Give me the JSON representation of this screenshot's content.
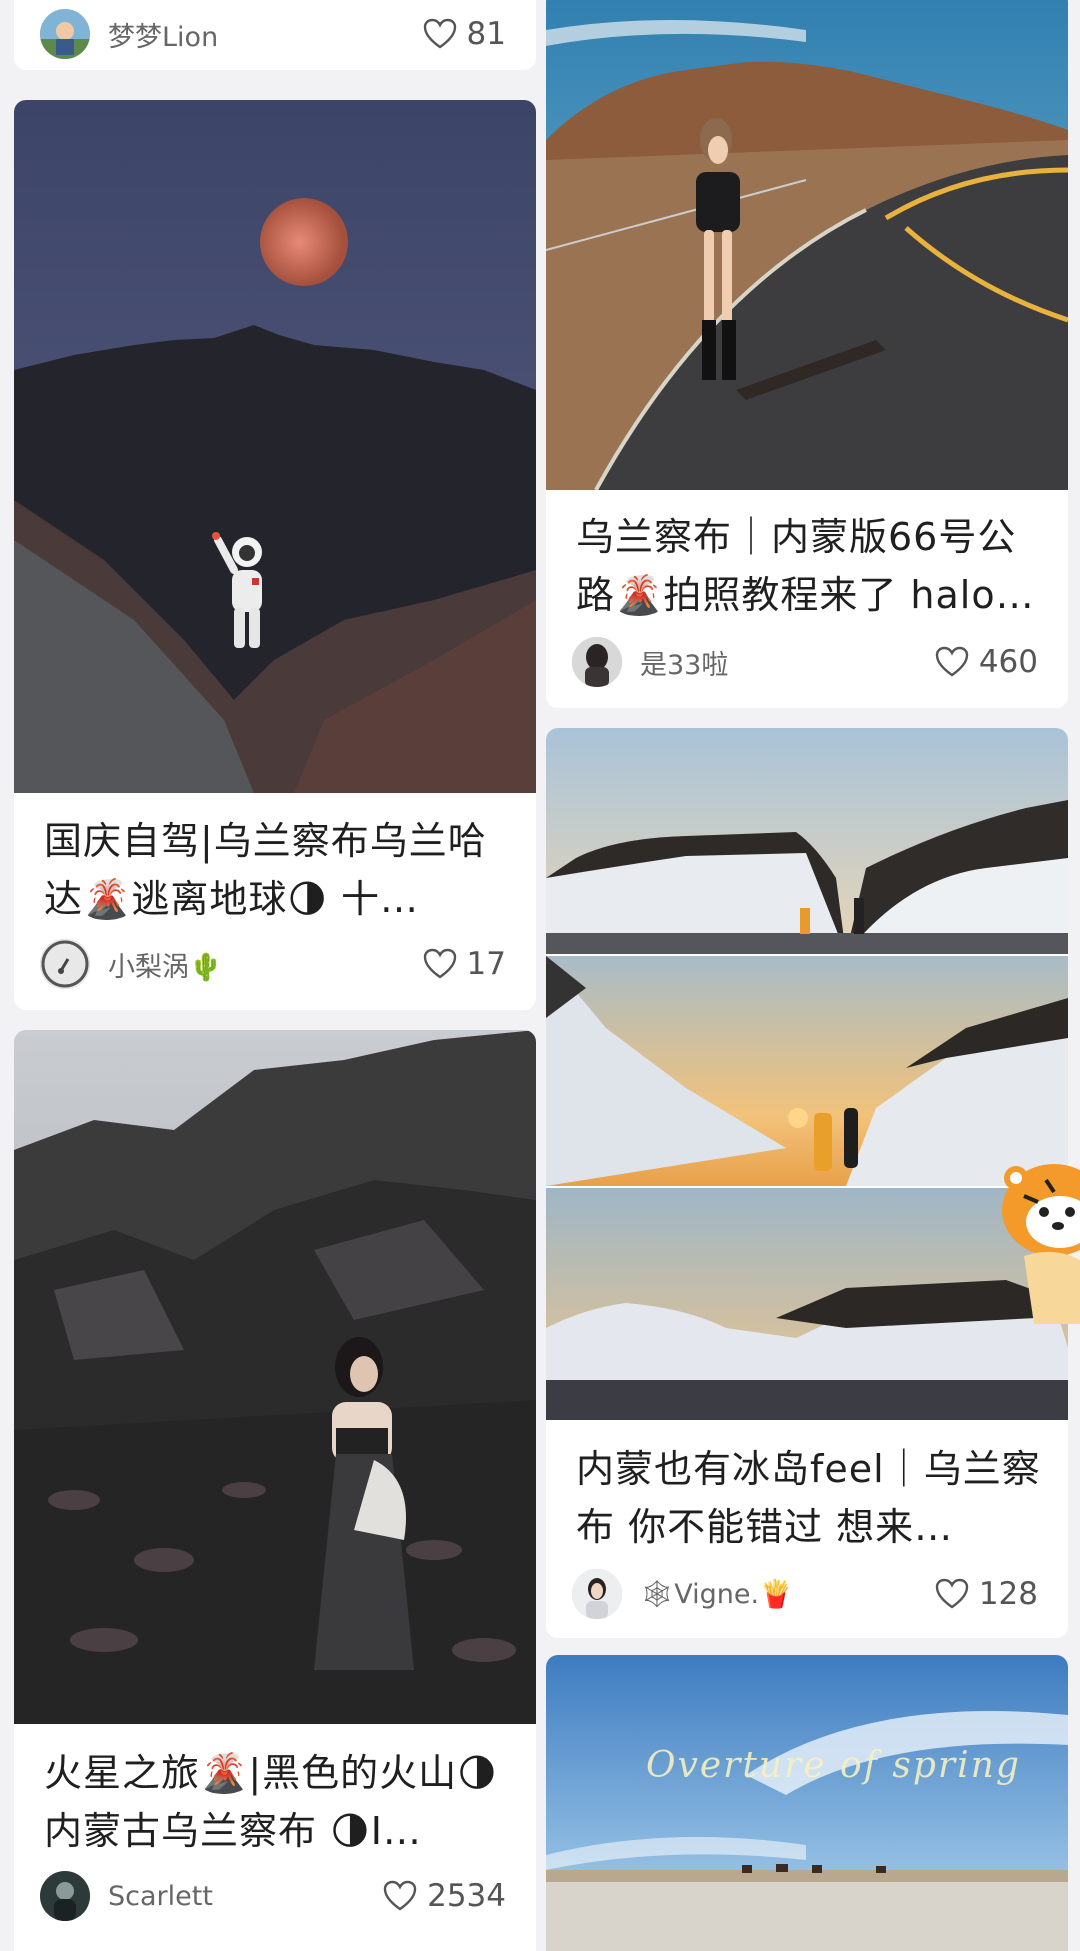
{
  "feed": {
    "left": [
      {
        "title": "",
        "author": "梦梦Lion",
        "likes": "81",
        "image": "",
        "avatar": "avatar-lion"
      },
      {
        "title": "国庆自驾|乌兰察布乌兰哈达🌋逃离地球🌗 十…",
        "author": "小梨涡🌵",
        "likes": "17",
        "image": "astronaut-under-blood-moon-on-volcanic-rock",
        "avatar": "avatar-round-icon"
      },
      {
        "title": "火星之旅🌋|黑色的火山🌗内蒙古乌兰察布 🌗I…",
        "author": "Scarlett",
        "likes": "2534",
        "image": "woman-in-black-dress-on-volcanic-field",
        "avatar": "avatar-scarlett"
      }
    ],
    "right": [
      {
        "title": "乌兰察布｜内蒙版66号公路🌋拍照教程来了 halo…",
        "author": "是33啦",
        "likes": "460",
        "image": "woman-walking-on-curved-road-by-volcano",
        "avatar": "avatar-33"
      },
      {
        "title": "内蒙也有冰岛feel｜乌兰察布 你不能错过 想来…",
        "author": "🕸Vigne.🍟",
        "likes": "128",
        "image": "snowy-volcanic-mountains-at-sunset-collage",
        "avatar": "avatar-vigne"
      },
      {
        "title": "",
        "author": "",
        "likes": "",
        "image": "",
        "overlay_text": "Overture of spring",
        "avatar": ""
      }
    ]
  },
  "colors": {
    "page_bg": "#f2f2f4",
    "card_bg": "#ffffff",
    "title": "#1f1f1f",
    "meta": "#666666"
  }
}
